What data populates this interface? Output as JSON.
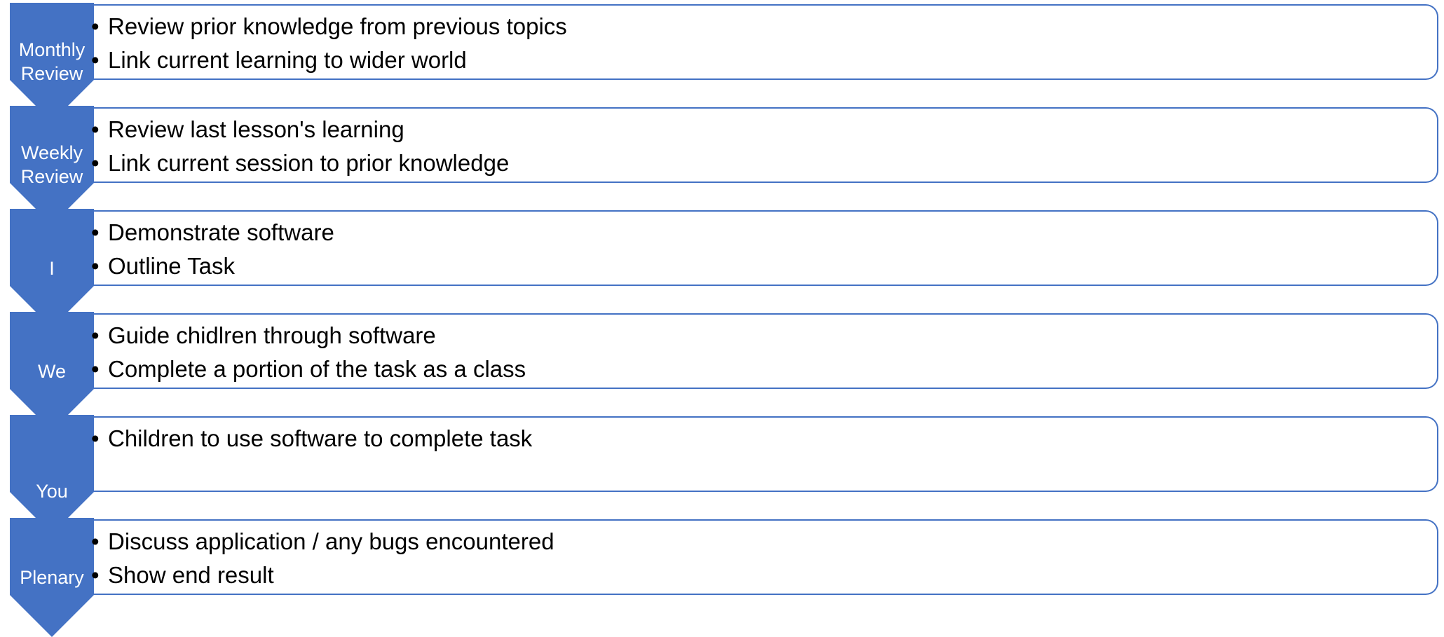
{
  "colors": {
    "accent": "#4472c4",
    "label_text": "#ffffff",
    "body_text": "#000000"
  },
  "steps": [
    {
      "label": "Monthly\nReview",
      "bullets": [
        "Review prior knowledge from previous topics",
        "Link current learning to wider world"
      ]
    },
    {
      "label": "Weekly\nReview",
      "bullets": [
        "Review last lesson's learning",
        "Link current session to prior knowledge"
      ]
    },
    {
      "label": "I",
      "bullets": [
        "Demonstrate software",
        "Outline Task"
      ]
    },
    {
      "label": "We",
      "bullets": [
        "Guide chidlren through software",
        "Complete a portion of the task as a class"
      ]
    },
    {
      "label": "You",
      "bullets": [
        "Children to use software to complete task"
      ]
    },
    {
      "label": "Plenary",
      "bullets": [
        "Discuss application / any bugs encountered",
        "Show end result"
      ]
    }
  ]
}
